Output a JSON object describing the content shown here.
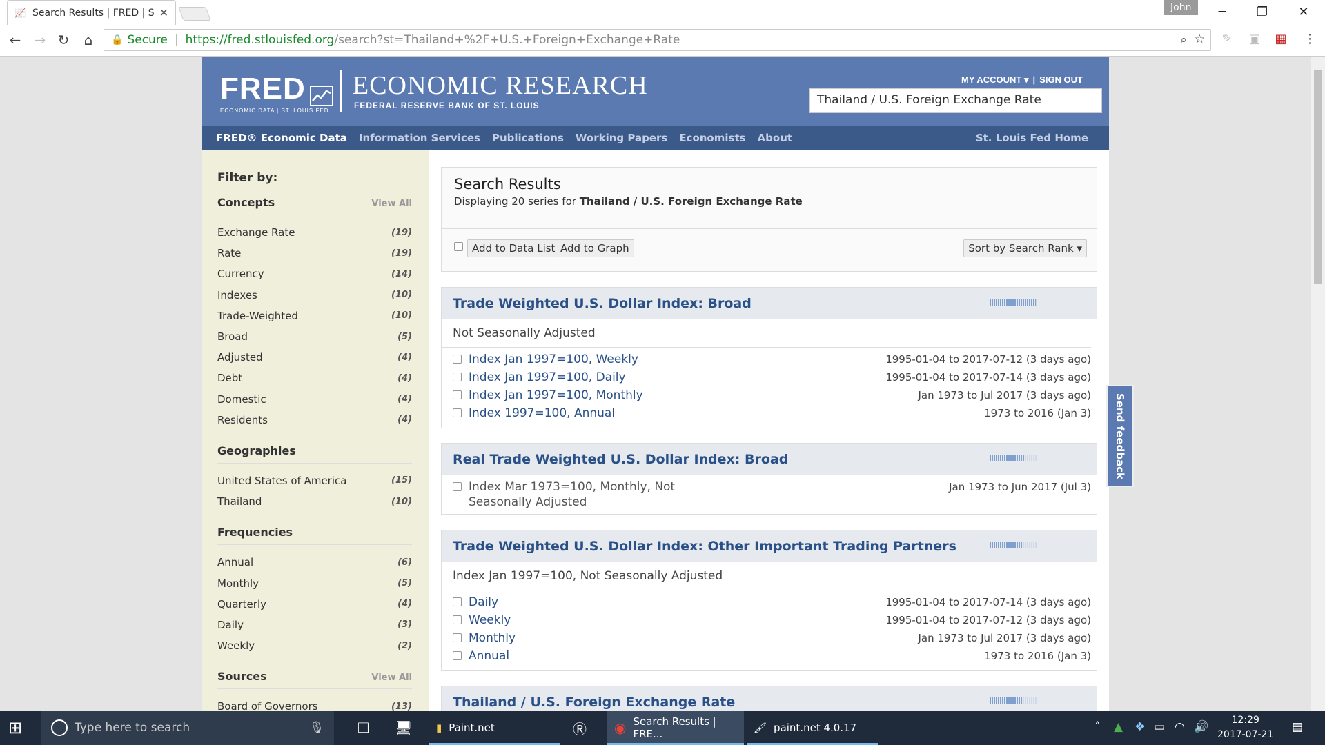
{
  "browser": {
    "tab_title": "Search Results | FRED | St",
    "user": "John",
    "secure_label": "Secure",
    "url_host": "https://fred.stlouisfed.org",
    "url_path": "/search?st=Thailand+%2F+U.S.+Foreign+Exchange+Rate"
  },
  "header": {
    "logo": "FRED",
    "logo_sub": "ECONOMIC DATA | ST. LOUIS FED",
    "title": "ECONOMIC RESEARCH",
    "subtitle": "FEDERAL RESERVE BANK OF ST. LOUIS",
    "my_account": "MY ACCOUNT ▾",
    "sign_out": "SIGN OUT",
    "search_value": "Thailand / U.S. Foreign Exchange Rate"
  },
  "nav": {
    "items": [
      "FRED® Economic Data",
      "Information Services",
      "Publications",
      "Working Papers",
      "Economists",
      "About"
    ],
    "home": "St. Louis Fed Home"
  },
  "sidebar": {
    "filter_by": "Filter by:",
    "view_all": "View All",
    "concepts_title": "Concepts",
    "concepts": [
      {
        "label": "Exchange Rate",
        "count": "(19)"
      },
      {
        "label": "Rate",
        "count": "(19)"
      },
      {
        "label": "Currency",
        "count": "(14)"
      },
      {
        "label": "Indexes",
        "count": "(10)"
      },
      {
        "label": "Trade-Weighted",
        "count": "(10)"
      },
      {
        "label": "Broad",
        "count": "(5)"
      },
      {
        "label": "Adjusted",
        "count": "(4)"
      },
      {
        "label": "Debt",
        "count": "(4)"
      },
      {
        "label": "Domestic",
        "count": "(4)"
      },
      {
        "label": "Residents",
        "count": "(4)"
      }
    ],
    "geographies_title": "Geographies",
    "geographies": [
      {
        "label": "United States of America",
        "count": "(15)"
      },
      {
        "label": "Thailand",
        "count": "(10)"
      }
    ],
    "frequencies_title": "Frequencies",
    "frequencies": [
      {
        "label": "Annual",
        "count": "(6)"
      },
      {
        "label": "Monthly",
        "count": "(5)"
      },
      {
        "label": "Quarterly",
        "count": "(4)"
      },
      {
        "label": "Daily",
        "count": "(3)"
      },
      {
        "label": "Weekly",
        "count": "(2)"
      }
    ],
    "sources_title": "Sources",
    "sources": [
      {
        "label": "Board of Governors",
        "count": "(13)"
      }
    ]
  },
  "results": {
    "title": "Search Results",
    "displaying": "Displaying 20 series for ",
    "query": "Thailand / U.S. Foreign Exchange Rate",
    "add_data_list": "Add to Data List",
    "add_graph": "Add to Graph",
    "sort": "Sort by Search Rank ▾",
    "items": [
      {
        "title": "Trade Weighted U.S. Dollar Index: Broad",
        "popularity": 0.98,
        "subtitle": "Not Seasonally Adjusted",
        "rows": [
          {
            "label": "Index Jan 1997=100, Weekly",
            "dates": "1995-01-04 to 2017-07-12 (3 days ago)"
          },
          {
            "label": "Index Jan 1997=100, Daily",
            "dates": "1995-01-04 to 2017-07-14 (3 days ago)"
          },
          {
            "label": "Index Jan 1997=100, Monthly",
            "dates": "Jan 1973 to Jul 2017 (3 days ago)"
          },
          {
            "label": "Index 1997=100, Annual",
            "dates": "1973 to 2016 (Jan 3)"
          }
        ]
      },
      {
        "title": "Real Trade Weighted U.S. Dollar Index: Broad",
        "popularity": 0.75,
        "rows": [
          {
            "label": "Index Mar 1973=100, Monthly, Not Seasonally Adjusted",
            "dates": "Jan 1973 to Jun 2017 (Jul 3)"
          }
        ]
      },
      {
        "title": "Trade Weighted U.S. Dollar Index: Other Important Trading Partners",
        "popularity": 0.7,
        "subtitle": "Index Jan 1997=100, Not Seasonally Adjusted",
        "rows": [
          {
            "label": "Daily",
            "dates": "1995-01-04 to 2017-07-14 (3 days ago)"
          },
          {
            "label": "Weekly",
            "dates": "1995-01-04 to 2017-07-12 (3 days ago)"
          },
          {
            "label": "Monthly",
            "dates": "Jan 1973 to Jul 2017 (3 days ago)"
          },
          {
            "label": "Annual",
            "dates": "1973 to 2016 (Jan 3)"
          }
        ]
      },
      {
        "title": "Thailand / U.S. Foreign Exchange Rate",
        "popularity": 0.7
      }
    ]
  },
  "feedback": "Send feedback",
  "taskbar": {
    "search_placeholder": "Type here to search",
    "paint_folder": "Paint.net",
    "chrome": "Search Results | FRE...",
    "paintnet": "paint.net 4.0.17",
    "time": "12:29",
    "date": "2017-07-21"
  }
}
